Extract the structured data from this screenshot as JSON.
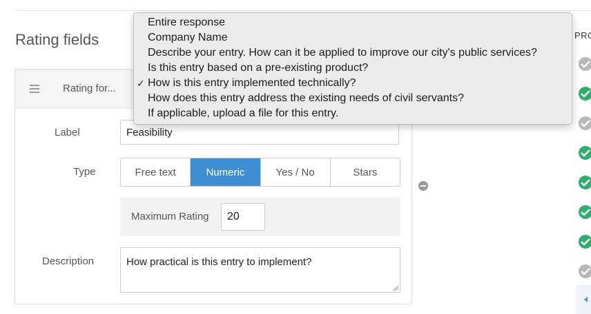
{
  "section": {
    "title": "Rating fields"
  },
  "rating_field": {
    "header_title": "Rating for...",
    "label_caption": "Label",
    "label_value": "Feasibility",
    "type_caption": "Type",
    "type_options": [
      "Free text",
      "Numeric",
      "Yes / No",
      "Stars"
    ],
    "selected_type": "Numeric",
    "max_rating_caption": "Maximum Rating",
    "max_rating_value": "20",
    "description_caption": "Description",
    "description_value": "How practical is this entry to implement?"
  },
  "right_column": {
    "header": "PRO",
    "status_icons": [
      "pending",
      "ok",
      "pending",
      "ok",
      "ok",
      "ok",
      "ok",
      "pending"
    ]
  },
  "dropdown": {
    "items": [
      "Entire response",
      "Company Name",
      "Describe your entry. How can it be applied to improve our city's public services?",
      "Is this entry based on a pre-existing product?",
      "How is this entry implemented technically?",
      "How does this entry address the existing needs of civil servants?",
      "If applicable, upload a file for this entry."
    ],
    "checked_index": 4,
    "check_mark": "✓"
  },
  "colors": {
    "accent": "#3d8fd1",
    "ok": "#2eae6c",
    "pending": "#b8b8b8"
  }
}
